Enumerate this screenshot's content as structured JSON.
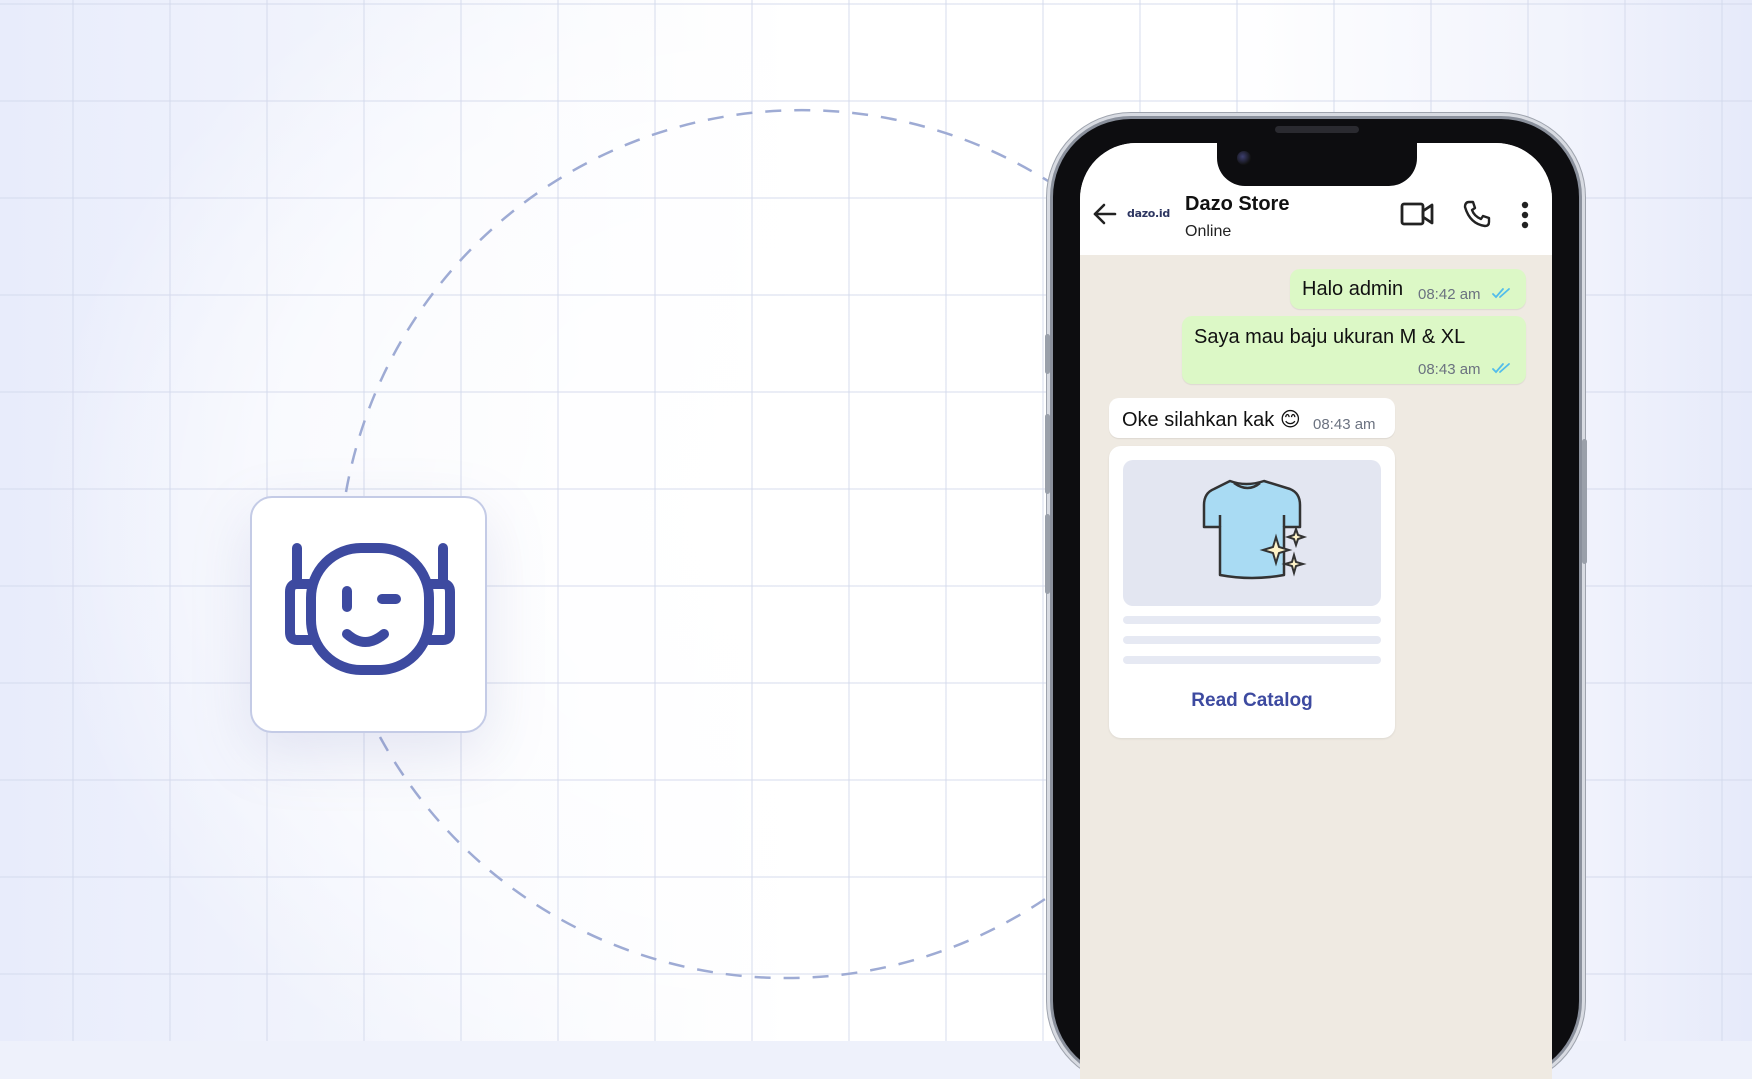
{
  "colors": {
    "accent": "#3d4aa0",
    "outgoing_bubble": "#dcf8c6",
    "incoming_bubble": "#ffffff",
    "chat_background": "#efeae2",
    "tick_blue": "#53bdeb"
  },
  "bot": {
    "icon": "robot-face-wink-icon"
  },
  "chat": {
    "header": {
      "brand": "dazo.id",
      "name": "Dazo Store",
      "status": "Online",
      "icons": [
        "back-arrow-icon",
        "video-call-icon",
        "phone-call-icon",
        "more-vertical-icon"
      ]
    },
    "messages": [
      {
        "direction": "out",
        "text": "Halo admin",
        "time": "08:42 am",
        "status": "read"
      },
      {
        "direction": "out",
        "text": "Saya mau baju ukuran M & XL",
        "time": "08:43 am",
        "status": "read"
      },
      {
        "direction": "in",
        "text": "Oke silahkan kak 😊",
        "time": "08:43 am"
      }
    ],
    "catalog": {
      "image_icon": "tshirt-sparkle-icon",
      "button": "Read Catalog"
    }
  }
}
